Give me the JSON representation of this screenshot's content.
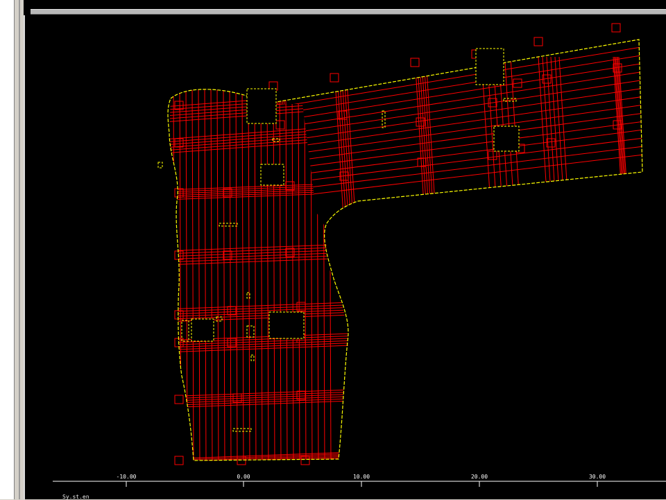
{
  "window": {
    "status_label": "Sy.st.en"
  },
  "plot": {
    "background_color": "#000000",
    "outline_color": "#ffff00",
    "grid_color": "#ff0000",
    "axis_color": "#ffffff",
    "axis_tick_labels": [
      "-10.00",
      "0.00",
      "10.00",
      "20.00",
      "30.00"
    ]
  }
}
